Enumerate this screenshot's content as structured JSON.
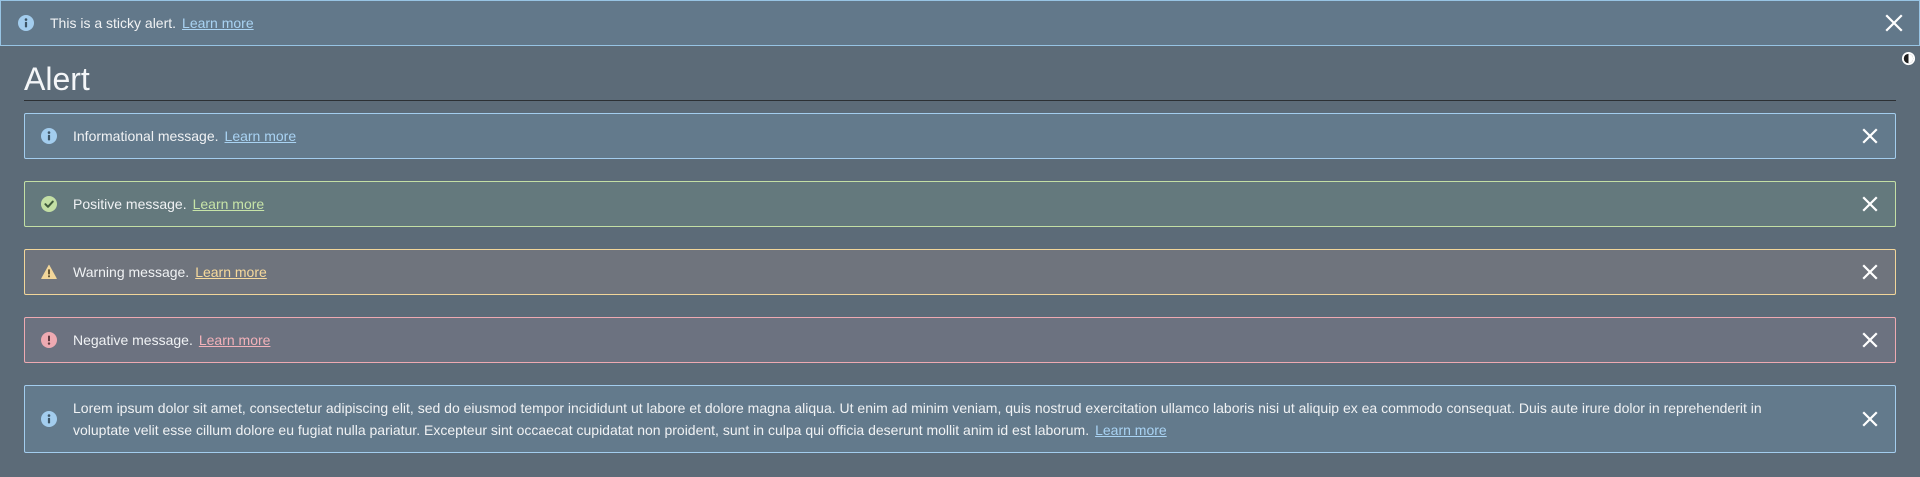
{
  "sticky": {
    "text": "This is a sticky alert.",
    "link": "Learn more",
    "icon": "info-icon"
  },
  "page": {
    "title": "Alert"
  },
  "alerts": [
    {
      "variant": "info",
      "icon": "info-icon",
      "text": "Informational message.",
      "link": "Learn more"
    },
    {
      "variant": "positive",
      "icon": "check-circle-icon",
      "text": "Positive message.",
      "link": "Learn more"
    },
    {
      "variant": "warning",
      "icon": "warning-triangle-icon",
      "text": "Warning message.",
      "link": "Learn more"
    },
    {
      "variant": "negative",
      "icon": "exclamation-circle-icon",
      "text": "Negative message.",
      "link": "Learn more"
    },
    {
      "variant": "info",
      "icon": "info-icon",
      "text": "Lorem ipsum dolor sit amet, consectetur adipiscing elit, sed do eiusmod tempor incididunt ut labore et dolore magna aliqua. Ut enim ad minim veniam, quis nostrud exercitation ullamco laboris nisi ut aliquip ex ea commodo consequat. Duis aute irure dolor in reprehenderit in voluptate velit esse cillum dolore eu fugiat nulla pariatur. Excepteur sint occaecat cupidatat non proident, sunt in culpa qui officia deserunt mollit anim id est laborum.",
      "link": "Learn more"
    }
  ],
  "colors": {
    "info": "#a3cdee",
    "positive": "#c3dfa5",
    "warning": "#f2d69a",
    "negative": "#eeaab2"
  }
}
